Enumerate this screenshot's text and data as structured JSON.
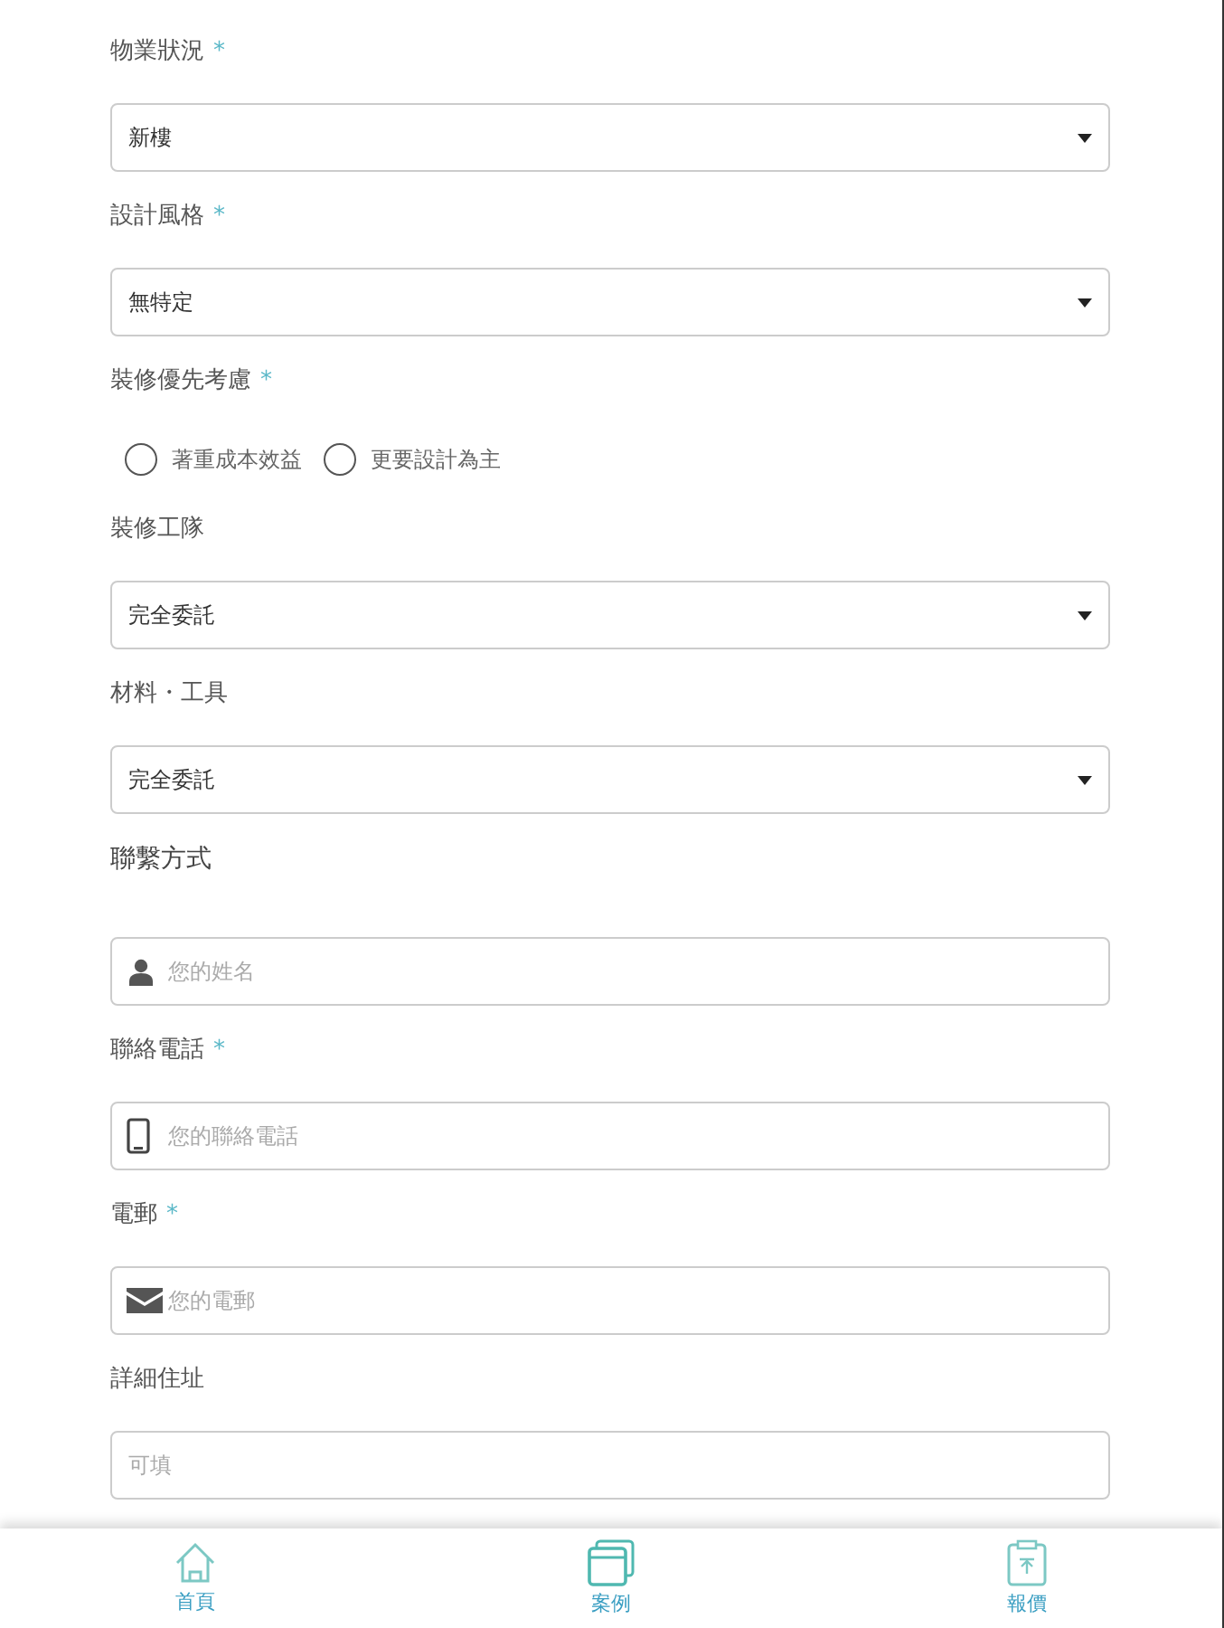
{
  "form": [
    {
      "kind": "select",
      "label": "物業狀況",
      "required_mark": "*",
      "value": "新樓"
    },
    {
      "kind": "select",
      "label": "設計風格",
      "required_mark": "*",
      "value": "無特定"
    },
    {
      "kind": "radio",
      "label": "裝修優先考慮",
      "required_mark": "*",
      "options": [
        {
          "label": "著重成本效益",
          "selected": false
        },
        {
          "label": "更要設計為主",
          "selected": false
        }
      ]
    },
    {
      "kind": "select",
      "label": "裝修工隊",
      "value": "完全委託"
    },
    {
      "kind": "select",
      "label": "材料・工具",
      "value": "完全委託"
    },
    {
      "kind": "heading",
      "label": "聯繫方式"
    },
    {
      "kind": "input",
      "placeholder": "您的姓名"
    },
    {
      "kind": "label",
      "label": "聯絡電話",
      "required_mark": "*"
    },
    {
      "kind": "input",
      "placeholder": "您的聯絡電話"
    },
    {
      "kind": "label",
      "label": "電郵",
      "required_mark": "*"
    },
    {
      "kind": "input",
      "placeholder": "您的電郵"
    },
    {
      "kind": "label",
      "label": "詳細住址"
    },
    {
      "kind": "input",
      "placeholder": "可填"
    }
  ],
  "nav": [
    {
      "label": "首頁"
    },
    {
      "label": "案例"
    },
    {
      "label": "報價"
    }
  ]
}
